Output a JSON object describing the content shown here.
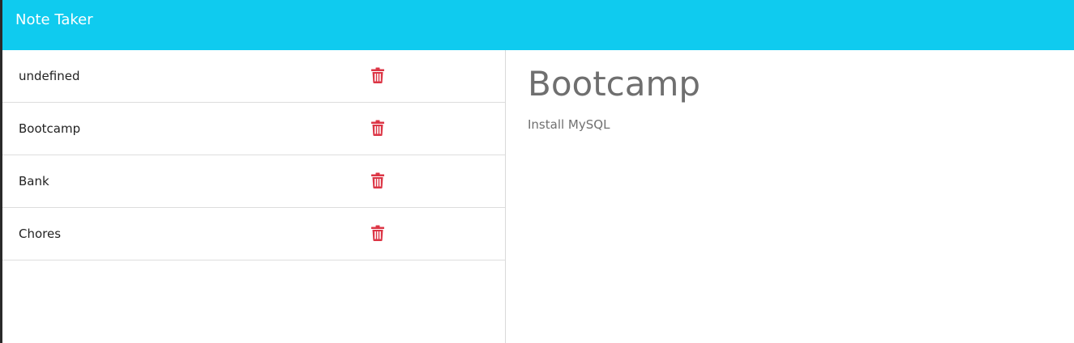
{
  "navbar": {
    "brand": "Note Taker",
    "background_color": "#0fcbef"
  },
  "notes": [
    {
      "title": "undefined",
      "icon": "trash-icon"
    },
    {
      "title": "Bootcamp",
      "icon": "trash-icon"
    },
    {
      "title": "Bank",
      "icon": "trash-icon"
    },
    {
      "title": "Chores",
      "icon": "trash-icon"
    }
  ],
  "active_note": {
    "title": "Bootcamp",
    "text": "Install MySQL"
  },
  "colors": {
    "delete_icon": "#dc3545",
    "heading_text": "#6f6f6f"
  }
}
